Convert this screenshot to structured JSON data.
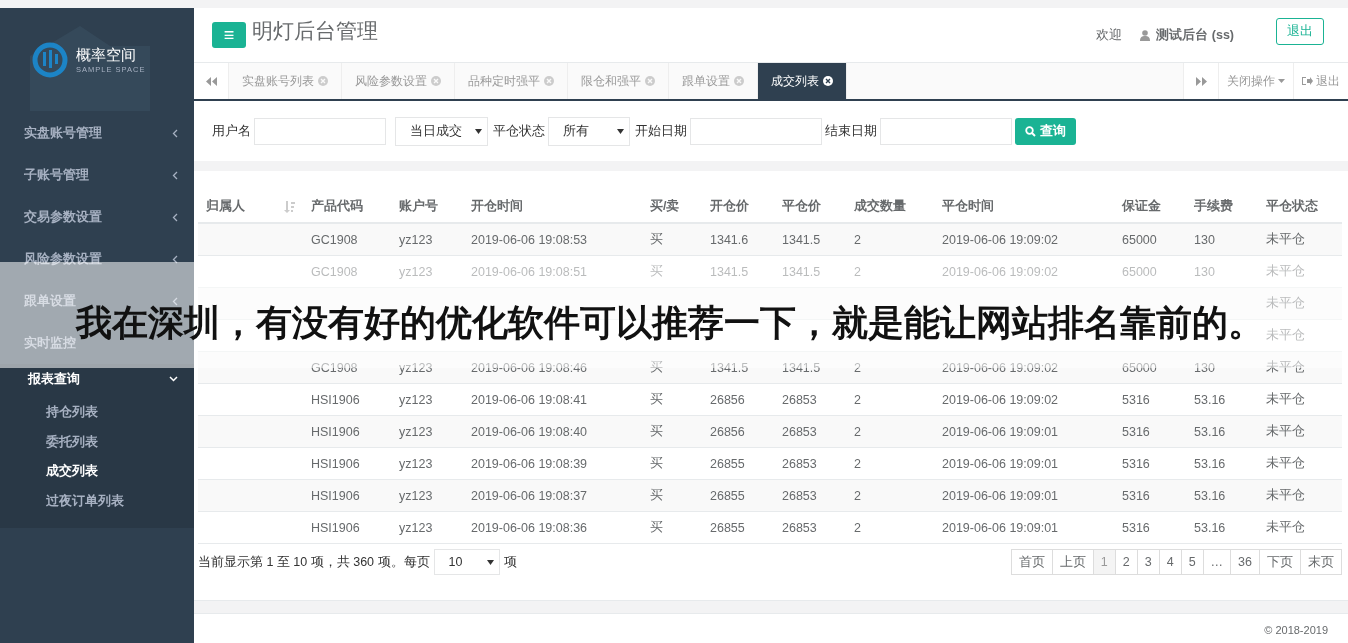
{
  "sidebar": {
    "logo": {
      "name": "概率空间",
      "subtitle": "SAMPLE SPACE"
    },
    "items": [
      {
        "label": "实盘账号管理",
        "expanded": false,
        "arrow": true
      },
      {
        "label": "子账号管理",
        "expanded": false,
        "arrow": true
      },
      {
        "label": "交易参数设置",
        "expanded": false,
        "arrow": true
      },
      {
        "label": "风险参数设置",
        "expanded": false,
        "arrow": true
      },
      {
        "label": "跟单设置",
        "expanded": false,
        "arrow": true
      },
      {
        "label": "实时监控",
        "expanded": false,
        "arrow": false
      },
      {
        "label": "报表查询",
        "expanded": true,
        "arrow": true,
        "children": [
          {
            "label": "持仓列表",
            "selected": false
          },
          {
            "label": "委托列表",
            "selected": false
          },
          {
            "label": "成交列表",
            "selected": true
          },
          {
            "label": "过夜订单列表",
            "selected": false
          }
        ]
      }
    ]
  },
  "header": {
    "menu_icon": "≡",
    "title": "明灯后台管理",
    "welcome": "欢迎",
    "user": "测试后台 (ss)",
    "logout": "退出"
  },
  "tabs": {
    "items": [
      {
        "label": "实盘账号列表",
        "selected": false
      },
      {
        "label": "风险参数设置",
        "selected": false
      },
      {
        "label": "品种定时强平",
        "selected": false
      },
      {
        "label": "限仓和强平",
        "selected": false
      },
      {
        "label": "跟单设置",
        "selected": false
      },
      {
        "label": "成交列表",
        "selected": true
      }
    ],
    "close_menu": "关闭操作",
    "logout": "退出"
  },
  "filters": [
    {
      "kind": "input",
      "label": "用户名"
    },
    {
      "kind": "select",
      "value": "当日成交"
    },
    {
      "kind": "select",
      "label": "平仓状态",
      "value": "所有"
    },
    {
      "kind": "input",
      "label": "开始日期"
    },
    {
      "kind": "input",
      "label": "结束日期"
    },
    {
      "kind": "button",
      "label": "查询"
    }
  ],
  "table": {
    "columns": [
      "归属人",
      "产品代码",
      "账户号",
      "开仓时间",
      "买/卖",
      "开仓价",
      "平仓价",
      "成交数量",
      "平仓时间",
      "保证金",
      "手续费",
      "平仓状态"
    ],
    "rows": [
      {
        "cells": [
          null,
          "GC1908",
          "yz123",
          "2019-06-06 19:08:53",
          "买",
          "1341.6",
          "1341.5",
          "2",
          "2019-06-06 19:09:02",
          "65000",
          "130",
          "未平仓"
        ]
      },
      {
        "cells": [
          null,
          "GC1908",
          "yz123",
          "2019-06-06 19:08:51",
          "买",
          "1341.5",
          "1341.5",
          "2",
          "2019-06-06 19:09:02",
          "65000",
          "130",
          "未平仓"
        ]
      },
      {
        "cells": [
          null,
          null,
          null,
          null,
          null,
          null,
          null,
          null,
          null,
          null,
          null,
          "未平仓"
        ]
      },
      {
        "cells": [
          null,
          null,
          null,
          null,
          null,
          null,
          null,
          null,
          null,
          null,
          null,
          "未平仓"
        ]
      },
      {
        "cells": [
          null,
          "GC1908",
          "yz123",
          "2019-06-06 19:08:46",
          "买",
          "1341.5",
          "1341.5",
          "2",
          "2019-06-06 19:09:02",
          "65000",
          "130",
          "未平仓"
        ]
      },
      {
        "cells": [
          null,
          "HSI1906",
          "yz123",
          "2019-06-06 19:08:41",
          "买",
          "26856",
          "26853",
          "2",
          "2019-06-06 19:09:02",
          "5316",
          "53.16",
          "未平仓"
        ]
      },
      {
        "cells": [
          null,
          "HSI1906",
          "yz123",
          "2019-06-06 19:08:40",
          "买",
          "26856",
          "26853",
          "2",
          "2019-06-06 19:09:01",
          "5316",
          "53.16",
          "未平仓"
        ]
      },
      {
        "cells": [
          null,
          "HSI1906",
          "yz123",
          "2019-06-06 19:08:39",
          "买",
          "26855",
          "26853",
          "2",
          "2019-06-06 19:09:01",
          "5316",
          "53.16",
          "未平仓"
        ]
      },
      {
        "cells": [
          null,
          "HSI1906",
          "yz123",
          "2019-06-06 19:08:37",
          "买",
          "26855",
          "26853",
          "2",
          "2019-06-06 19:09:01",
          "5316",
          "53.16",
          "未平仓"
        ]
      },
      {
        "cells": [
          null,
          "HSI1906",
          "yz123",
          "2019-06-06 19:08:36",
          "买",
          "26855",
          "26853",
          "2",
          "2019-06-06 19:09:01",
          "5316",
          "53.16",
          "未平仓"
        ]
      }
    ]
  },
  "footer": {
    "info": "当前显示第 1 至 10 项，共 360 项。每页",
    "page_size": "10",
    "unit": "项",
    "pages": [
      {
        "label": "首页",
        "selected": false
      },
      {
        "label": "上页",
        "selected": false
      },
      {
        "label": "1",
        "selected": true
      },
      {
        "label": "2",
        "selected": false
      },
      {
        "label": "3",
        "selected": false
      },
      {
        "label": "4",
        "selected": false
      },
      {
        "label": "5",
        "selected": false
      },
      {
        "label": "…",
        "selected": false
      },
      {
        "label": "36",
        "selected": false
      },
      {
        "label": "下页",
        "selected": false
      },
      {
        "label": "末页",
        "selected": false
      }
    ],
    "copyright": "© 2018-2019"
  },
  "overlay_caption": "我在深圳，有没有好的优化软件可以推荐一下，就是能让网站排名靠前的。"
}
